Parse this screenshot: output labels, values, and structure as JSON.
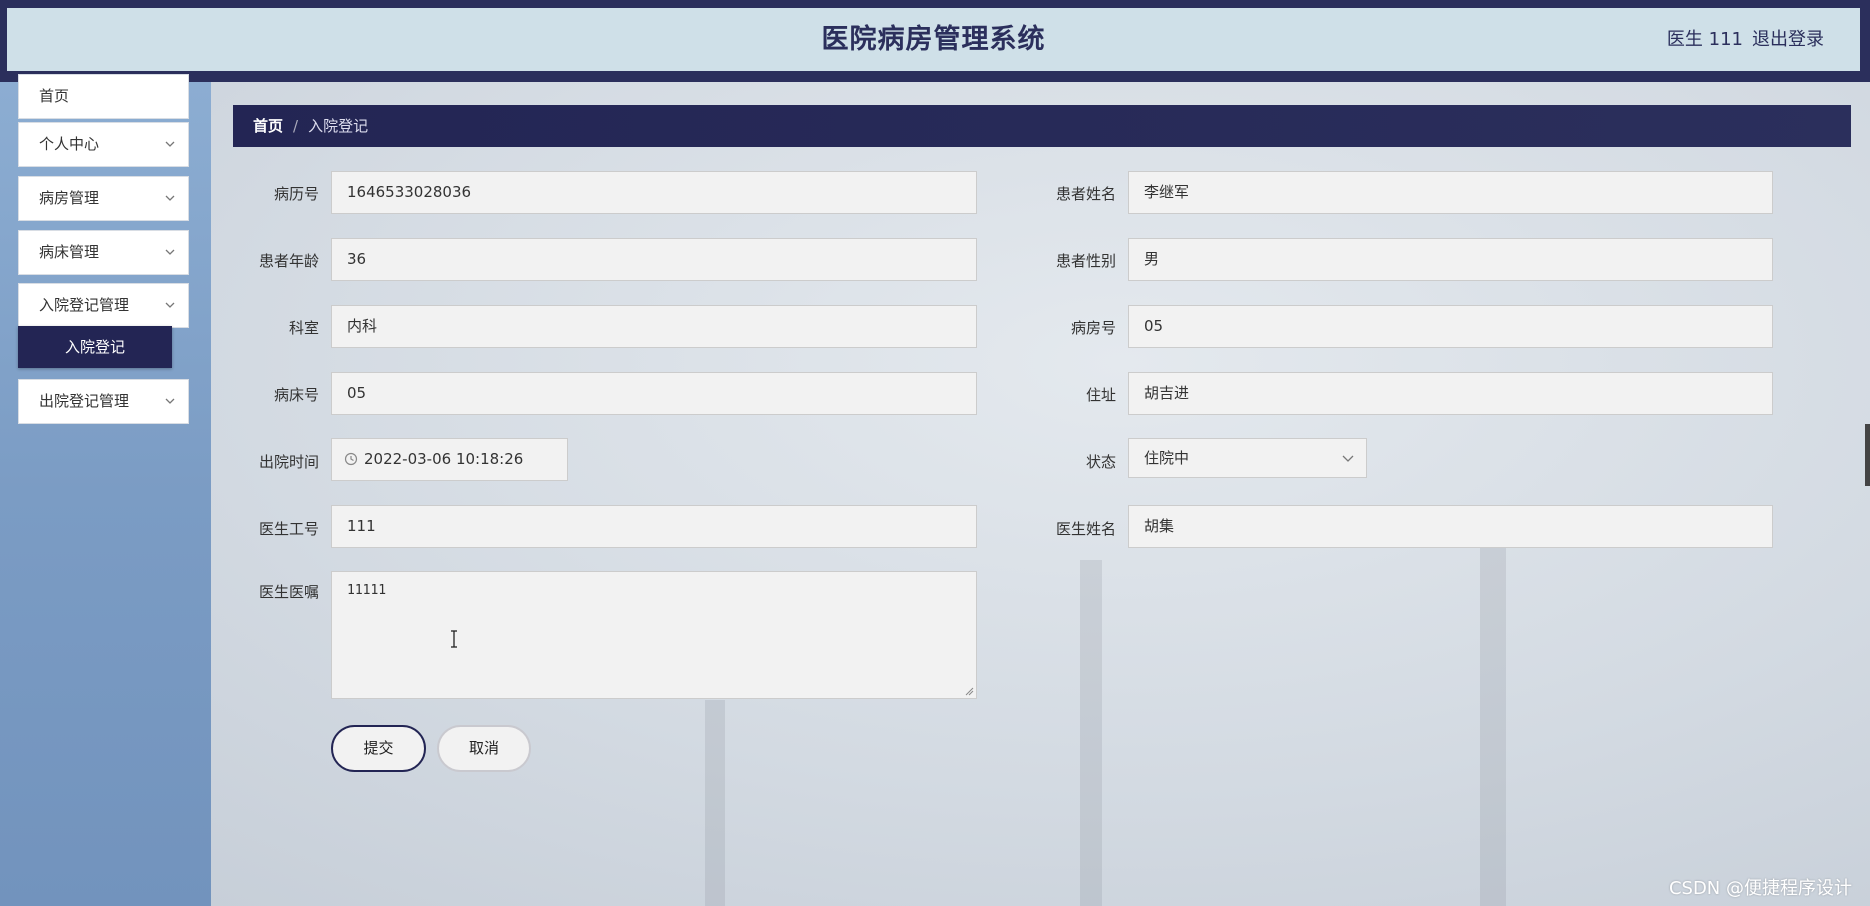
{
  "header": {
    "title": "医院病房管理系统",
    "user": "医生 111",
    "logout_label": "退出登录"
  },
  "sidebar": {
    "items": [
      {
        "label": "首页"
      },
      {
        "label": "个人中心"
      },
      {
        "label": "病房管理"
      },
      {
        "label": "病床管理"
      },
      {
        "label": "入院登记管理"
      },
      {
        "label": "出院登记管理"
      }
    ],
    "active_sub": "入院登记"
  },
  "breadcrumb": {
    "home": "首页",
    "separator": "/",
    "current": "入院登记"
  },
  "form": {
    "record_no": {
      "label": "病历号",
      "value": "1646533028036"
    },
    "patient_name": {
      "label": "患者姓名",
      "value": "李继军"
    },
    "patient_age": {
      "label": "患者年龄",
      "value": "36"
    },
    "patient_gender": {
      "label": "患者性别",
      "value": "男"
    },
    "department": {
      "label": "科室",
      "value": "内科"
    },
    "ward_no": {
      "label": "病房号",
      "value": "05"
    },
    "bed_no": {
      "label": "病床号",
      "value": "05"
    },
    "address": {
      "label": "住址",
      "value": "胡吉进"
    },
    "discharge_time": {
      "label": "出院时间",
      "value": "2022-03-06 10:18:26"
    },
    "status": {
      "label": "状态",
      "value": "住院中"
    },
    "doctor_id": {
      "label": "医生工号",
      "value": "111"
    },
    "doctor_name": {
      "label": "医生姓名",
      "value": "胡集"
    },
    "doctor_advice": {
      "label": "医生医嘱",
      "value": "11111"
    },
    "submit_label": "提交",
    "cancel_label": "取消"
  },
  "watermark": "CSDN @便捷程序设计",
  "colors": {
    "primary": "#2b2f5c",
    "primary_dark": "#232554",
    "header_bg": "#cfe0e8",
    "sidebar_bg": "#7b9cc4",
    "field_bg": "#f2f2f2"
  }
}
